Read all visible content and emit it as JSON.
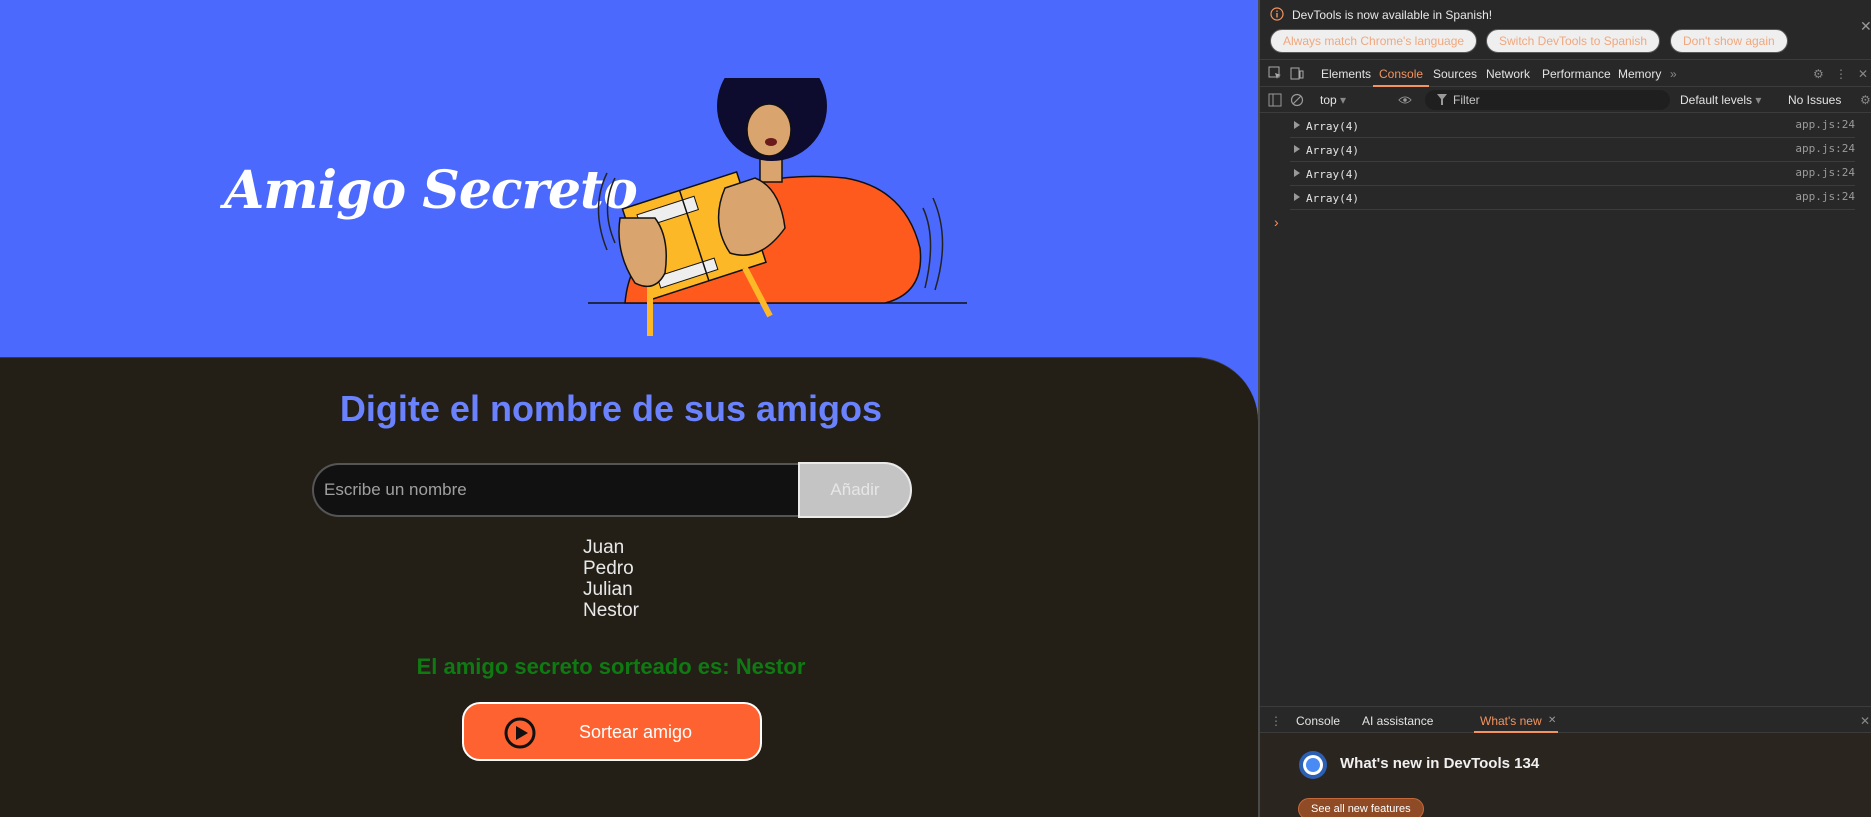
{
  "page": {
    "title": "Amigo Secreto",
    "heading": "Digite el nombre de sus amigos",
    "input_placeholder": "Escribe un nombre",
    "add_button": "Añadir",
    "friends": [
      "Juan",
      "Pedro",
      "Julian",
      "Nestor"
    ],
    "result": "El amigo secreto sorteado es: Nestor",
    "draw_button": "Sortear amigo",
    "colors": {
      "hero_bg": "#4b69fd",
      "panel_bg": "#231f17",
      "heading": "#6b82ff",
      "result": "#0f7a12",
      "draw_button": "#fe6230"
    }
  },
  "devtools": {
    "language_notice": "DevTools is now available in Spanish!",
    "language_buttons": [
      "Always match Chrome's language",
      "Switch DevTools to Spanish",
      "Don't show again"
    ],
    "tabs": [
      "Elements",
      "Console",
      "Sources",
      "Network",
      "Performance",
      "Memory"
    ],
    "active_tab": "Console",
    "toolbar": {
      "context": "top",
      "filter_placeholder": "Filter",
      "levels": "Default levels",
      "issues": "No Issues"
    },
    "logs": [
      {
        "text": "Array(4)",
        "source": "app.js:24"
      },
      {
        "text": "Array(4)",
        "source": "app.js:24"
      },
      {
        "text": "Array(4)",
        "source": "app.js:24"
      },
      {
        "text": "Array(4)",
        "source": "app.js:24"
      }
    ],
    "drawer": {
      "tabs": [
        "Console",
        "AI assistance",
        "What's new"
      ],
      "active_tab": "What's new",
      "title": "What's new in DevTools 134",
      "see_all": "See all new features"
    }
  }
}
